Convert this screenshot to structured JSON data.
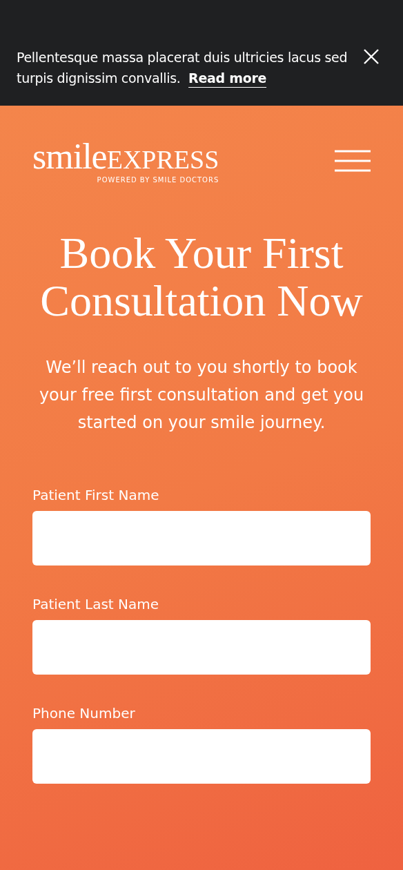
{
  "banner": {
    "message": "Pellentesque massa placerat duis ultricies lacus sed turpis dignissim convallis.",
    "link": "Read more"
  },
  "logo": {
    "word_1": "smile",
    "word_2": "EXPRESS",
    "tagline": "POWERED BY SMILE DOCTORS"
  },
  "heading": "Book Your First Consultation Now",
  "intro": "We’ll reach out to you shortly to book your free first consultation and get you started on your smile journey.",
  "fields": [
    {
      "label": "Patient First Name"
    },
    {
      "label": "Patient Last Name"
    },
    {
      "label": "Phone Number"
    }
  ]
}
